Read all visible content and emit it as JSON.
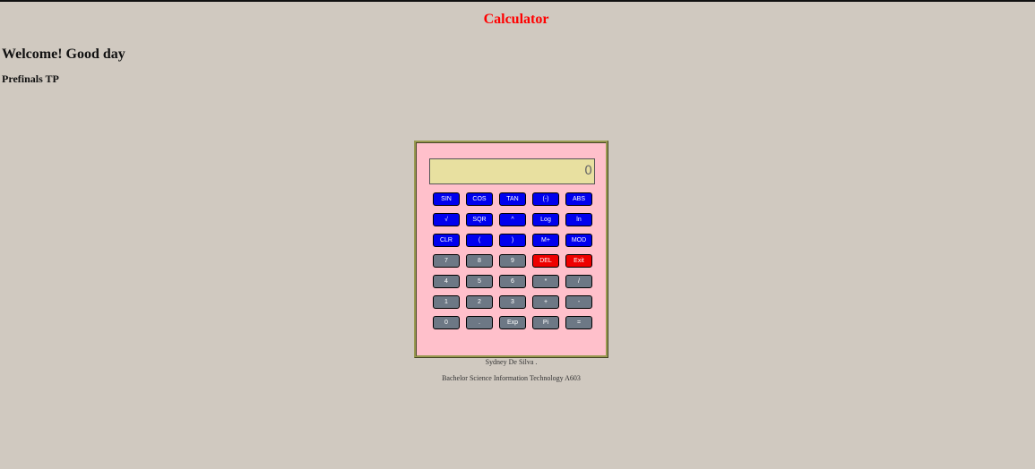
{
  "page": {
    "title": "Calculator",
    "welcome": "Welcome! Good day",
    "subtitle": "Prefinals TP"
  },
  "calculator": {
    "display_value": "0",
    "keys": [
      {
        "label": "SIN",
        "color": "blue"
      },
      {
        "label": "COS",
        "color": "blue"
      },
      {
        "label": "TAN",
        "color": "blue"
      },
      {
        "label": "(-)",
        "color": "blue"
      },
      {
        "label": "ABS",
        "color": "blue"
      },
      {
        "label": "√",
        "color": "blue"
      },
      {
        "label": "SQR",
        "color": "blue"
      },
      {
        "label": "^",
        "color": "blue"
      },
      {
        "label": "Log",
        "color": "blue"
      },
      {
        "label": "ln",
        "color": "blue"
      },
      {
        "label": "CLR",
        "color": "blue"
      },
      {
        "label": "(",
        "color": "blue"
      },
      {
        "label": ")",
        "color": "blue"
      },
      {
        "label": "M+",
        "color": "blue"
      },
      {
        "label": "MOD",
        "color": "blue"
      },
      {
        "label": "7",
        "color": "gray"
      },
      {
        "label": "8",
        "color": "gray"
      },
      {
        "label": "9",
        "color": "gray"
      },
      {
        "label": "DEL",
        "color": "red"
      },
      {
        "label": "Exit",
        "color": "red"
      },
      {
        "label": "4",
        "color": "gray"
      },
      {
        "label": "5",
        "color": "gray"
      },
      {
        "label": "6",
        "color": "gray"
      },
      {
        "label": "*",
        "color": "gray"
      },
      {
        "label": "/",
        "color": "gray"
      },
      {
        "label": "1",
        "color": "gray"
      },
      {
        "label": "2",
        "color": "gray"
      },
      {
        "label": "3",
        "color": "gray"
      },
      {
        "label": "+",
        "color": "gray"
      },
      {
        "label": "-",
        "color": "gray"
      },
      {
        "label": "0",
        "color": "gray"
      },
      {
        "label": ".",
        "color": "gray"
      },
      {
        "label": "Exp",
        "color": "gray"
      },
      {
        "label": "Pi",
        "color": "gray"
      },
      {
        "label": "=",
        "color": "gray"
      }
    ]
  },
  "footer": {
    "name": "Sydney De Silva .",
    "course": "Bachelor Science Information Technology A603"
  },
  "colors": {
    "background": "#d0c9c0",
    "title": "#ff0000",
    "calculator_body": "#ffc0cb",
    "display": "#e8e0a0",
    "blue_key": "#0000ee",
    "gray_key": "#6d7885",
    "red_key": "#ee0000"
  }
}
